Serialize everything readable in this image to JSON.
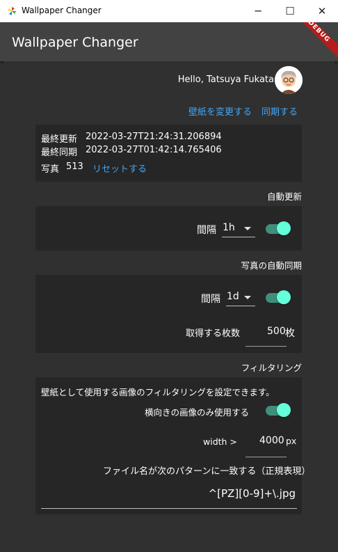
{
  "window": {
    "title": "Wallpaper Changer",
    "controls": {
      "minimize": "─",
      "maximize": "☐",
      "close": "✕"
    }
  },
  "appbar": {
    "title": "Wallpaper Changer",
    "debug_banner": "DEBUG"
  },
  "header": {
    "greeting": "Hello, Tatsuya Fukata",
    "change_wallpaper": "壁紙を変更する",
    "sync": "同期する"
  },
  "status": {
    "last_update_label": "最終更新",
    "last_update_value": "2022-03-27T21:24:31.206894",
    "last_sync_label": "最終同期",
    "last_sync_value": "2022-03-27T01:42:14.765406",
    "photos_label": "写真",
    "photos_count": "513",
    "reset": "リセットする"
  },
  "auto_update": {
    "section_title": "自動更新",
    "interval_label": "間隔",
    "interval_value": "1h",
    "enabled": true
  },
  "auto_sync": {
    "section_title": "写真の自動同期",
    "interval_label": "間隔",
    "interval_value": "1d",
    "enabled": true,
    "count_label": "取得する枚数",
    "count_value": "500",
    "count_unit": "枚"
  },
  "filtering": {
    "section_title": "フィルタリング",
    "description": "壁紙として使用する画像のフィルタリングを設定できます。",
    "landscape_label": "横向きの画像のみ使用する",
    "landscape_enabled": true,
    "width_label": "width >",
    "width_value": "4000",
    "width_unit": "px",
    "pattern_label": "ファイル名が次のパターンに一致する（正規表現）",
    "pattern_value": "^[PZ][0-9]+\\.jpg"
  },
  "colors": {
    "accent": "#64ffda",
    "link": "#42a5f5",
    "background": "#303030",
    "card": "#262626",
    "appbar": "#424242"
  }
}
